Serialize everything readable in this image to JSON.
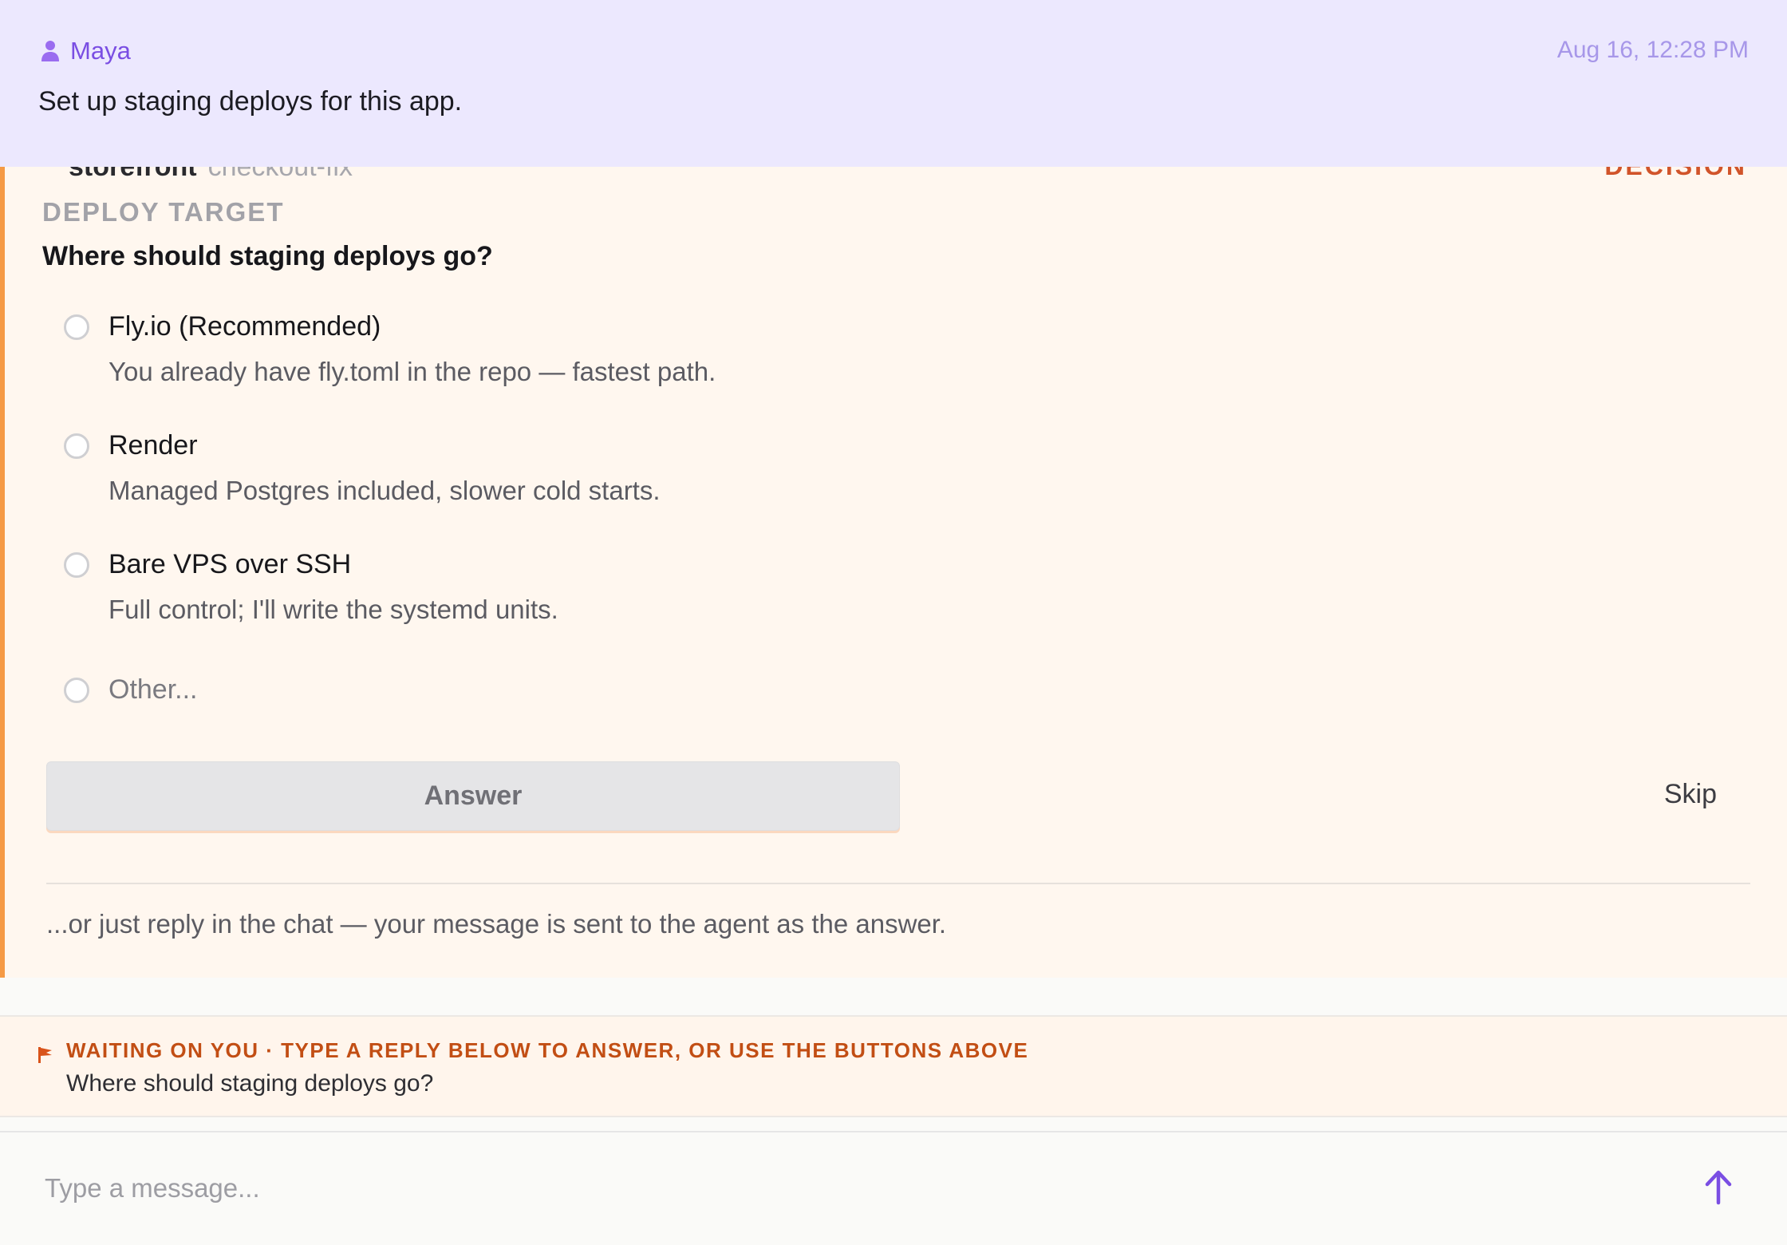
{
  "user_message": {
    "author": "Maya",
    "timestamp": "Aug 16, 12:28 PM",
    "text": "Set up staging deploys for this app."
  },
  "decision": {
    "peek_title": "storefront",
    "peek_subtitle": "checkout-fix",
    "peek_badge": "DECISION",
    "section_label": "DEPLOY TARGET",
    "question": "Where should staging deploys go?",
    "options": [
      {
        "label": "Fly.io (Recommended)",
        "description": "You already have fly.toml in the repo — fastest path."
      },
      {
        "label": "Render",
        "description": "Managed Postgres included, slower cold starts."
      },
      {
        "label": "Bare VPS over SSH",
        "description": "Full control; I'll write the systemd units."
      },
      {
        "label": "Other...",
        "description": ""
      }
    ],
    "answer_label": "Answer",
    "skip_label": "Skip",
    "chat_hint": "...or just reply in the chat — your message is sent to the agent as the answer."
  },
  "waiting_banner": {
    "title": "WAITING ON YOU · TYPE A REPLY BELOW TO ANSWER, OR USE THE BUTTONS ABOVE",
    "question": "Where should staging deploys go?"
  },
  "composer": {
    "placeholder": "Type a message..."
  },
  "colors": {
    "accent": "#7a4ee3",
    "decision_border": "#f59a45",
    "warning": "#c24e14",
    "user_bubble": "#ece8fe"
  },
  "icons": {
    "user": "person-icon",
    "flag": "flag-icon",
    "send": "arrow-up-icon"
  }
}
